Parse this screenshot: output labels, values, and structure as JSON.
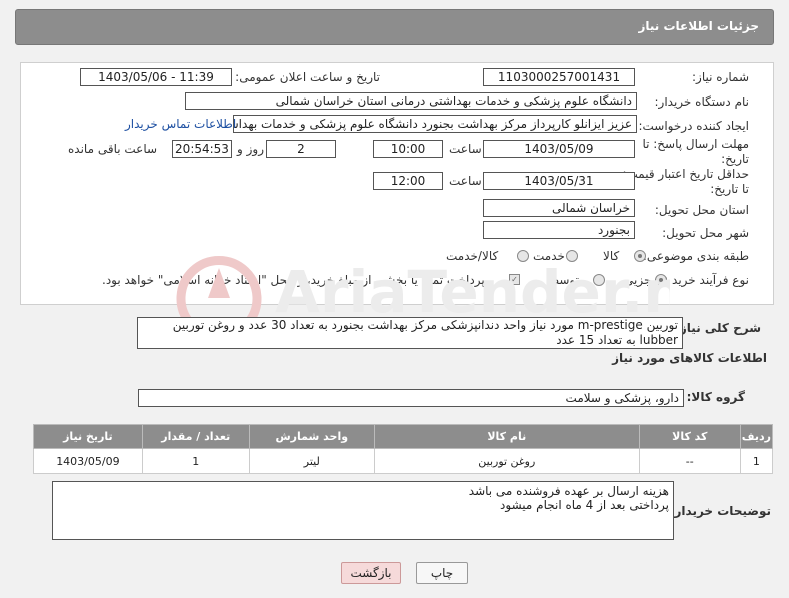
{
  "header": {
    "title": "جزئیات اطلاعات نیاز"
  },
  "fields": {
    "need_number_label": "شماره نیاز:",
    "need_number": "1103000257001431",
    "announce_label": "تاریخ و ساعت اعلان عمومی:",
    "announce_value": "1403/05/06 - 11:39",
    "buyer_org_label": "نام دستگاه خریدار:",
    "buyer_org": "دانشگاه علوم پزشکی و خدمات بهداشتی درمانی استان خراسان شمالی",
    "creator_label": "ایجاد کننده درخواست:",
    "creator": "عزیز ایزانلو کارپرداز مرکز بهداشت بجنورد دانشگاه علوم پزشکی و خدمات بهداشت",
    "contact_link": "اطلاعات تماس خریدار",
    "deadline_label": "مهلت ارسال پاسخ: تا تاریخ:",
    "deadline_date": "1403/05/09",
    "time_label": "ساعت",
    "deadline_time": "10:00",
    "days_value": "2",
    "days_label": "روز و",
    "remaining_time": "20:54:53",
    "remaining_label": "ساعت باقی مانده",
    "validity_label": "حداقل تاریخ اعتبار قیمت: تا تاریخ:",
    "validity_date": "1403/05/31",
    "validity_time": "12:00",
    "province_label": "استان محل تحویل:",
    "province": "خراسان شمالی",
    "city_label": "شهر محل تحویل:",
    "city": "بجنورد",
    "category_label": "طبقه بندی موضوعی:",
    "category_options": [
      "کالا",
      "خدمت",
      "کالا/خدمت"
    ],
    "purchase_label": "نوع فرآیند خرید :",
    "purchase_options": [
      "جزیی",
      "متوسط"
    ],
    "payment_note": "پرداخت تمام یا بخشی از مبلغ خرید،از محل \"اسناد خزانه اسلامی\" خواهد بود."
  },
  "description": {
    "label": "شرح کلی نیاز:",
    "text": "توربین m-prestige  مورد نیاز واحد دندانپزشکی مرکز بهداشت بجنورد به تعداد 30 عدد و روغن توربین lubber به تعداد 15 عدد"
  },
  "goods_section": {
    "title": "اطلاعات کالاهای مورد نیاز",
    "group_label": "گروه کالا:",
    "group_value": "دارو، پزشکی و سلامت"
  },
  "table": {
    "headers": [
      "ردیف",
      "کد کالا",
      "نام کالا",
      "واحد شمارش",
      "تعداد / مقدار",
      "تاریخ نیاز"
    ],
    "rows": [
      [
        "1",
        "--",
        "روغن توربین",
        "لیتر",
        "1",
        "1403/05/09"
      ]
    ]
  },
  "buyer_notes": {
    "label": "توضیحات خریدار:",
    "line1": "هزینه ارسال بر عهده فروشنده می باشد",
    "line2": "پرداختی بعد از 4 ماه انجام میشود"
  },
  "buttons": {
    "print": "چاپ",
    "back": "بازگشت"
  },
  "watermark": {
    "text": "AriaTender.neT"
  },
  "colors": {
    "header_bg": "#8d8d8d",
    "link": "#1e50a2",
    "back_btn_bg": "#f6dada"
  }
}
